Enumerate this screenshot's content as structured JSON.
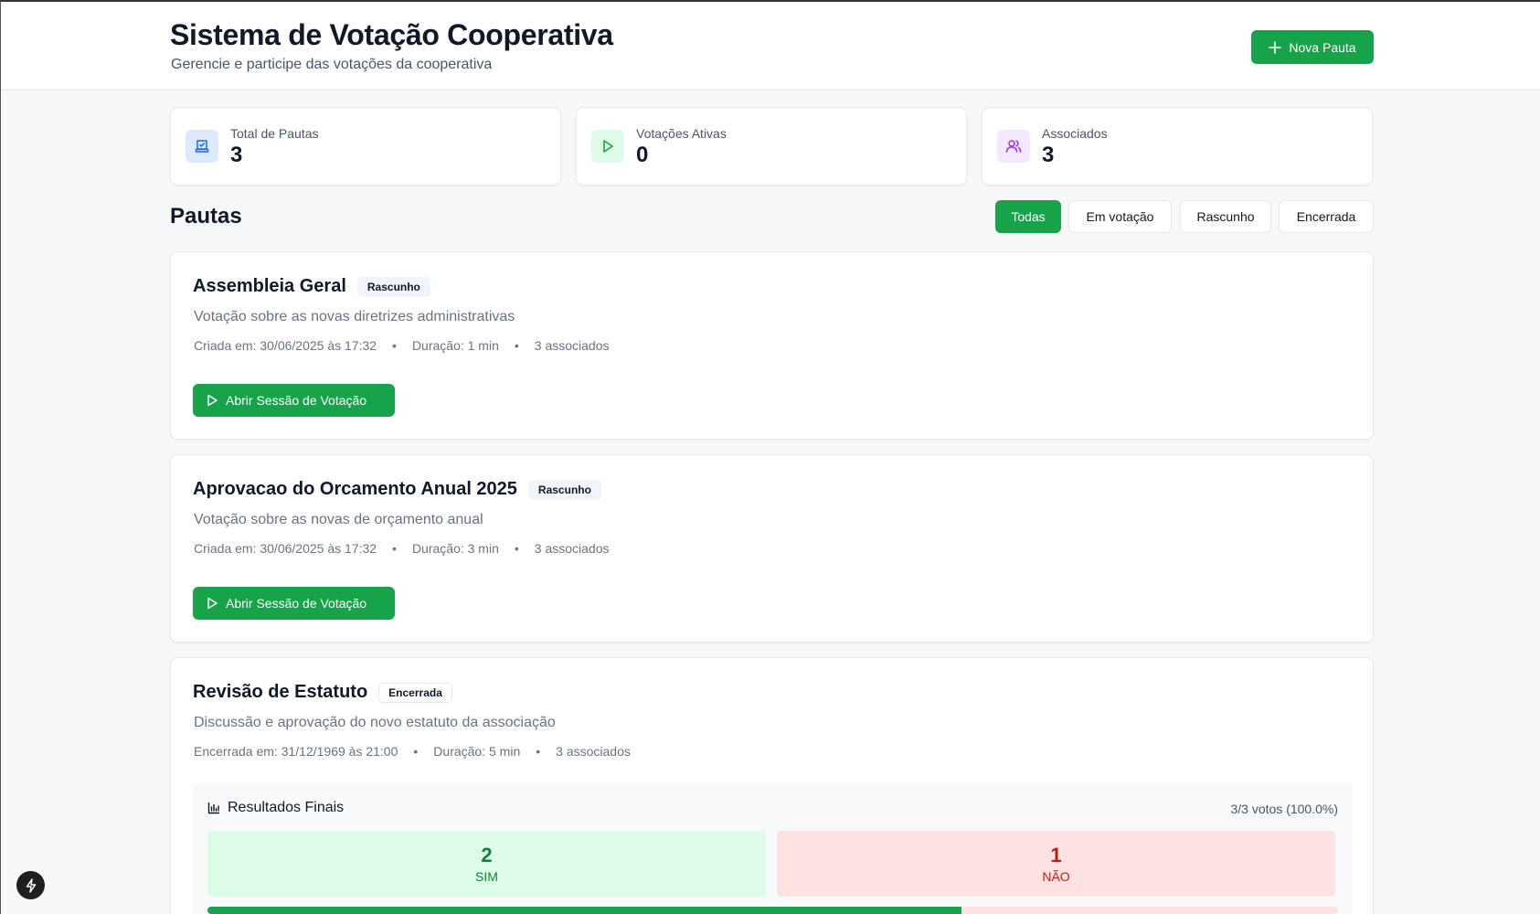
{
  "header": {
    "title": "Sistema de Votação Cooperativa",
    "subtitle": "Gerencie e participe das votações da cooperativa",
    "new_button_label": "Nova Pauta",
    "new_button_icon": "plus-icon"
  },
  "stats": [
    {
      "label": "Total de Pautas",
      "value": "3",
      "icon": "ballot-box-icon",
      "bg": "#dbeafe",
      "color": "#2563eb"
    },
    {
      "label": "Votações Ativas",
      "value": "0",
      "icon": "play-icon",
      "bg": "#dcfce7",
      "color": "#16a34a"
    },
    {
      "label": "Associados",
      "value": "3",
      "icon": "users-icon",
      "bg": "#f3e8ff",
      "color": "#9333ea"
    }
  ],
  "section": {
    "title": "Pautas",
    "filters": [
      "Todas",
      "Em votação",
      "Rascunho",
      "Encerrada"
    ],
    "active_filter": "Todas"
  },
  "pautas": [
    {
      "title": "Assembleia Geral",
      "status": "Rascunho",
      "description": "Votação sobre as novas diretrizes administrativas",
      "date": "Criada em: 30/06/2025 às 17:32",
      "duration": "Duração: 1 min",
      "members": "3 associados",
      "action_label": "Abrir Sessão de Votação"
    },
    {
      "title": "Aprovacao do Orcamento Anual 2025",
      "status": "Rascunho",
      "description": "Votação sobre as novas de orçamento anual",
      "date": "Criada em: 30/06/2025 às 17:32",
      "duration": "Duração: 3 min",
      "members": "3 associados",
      "action_label": "Abrir Sessão de Votação"
    },
    {
      "title": "Revisão de Estatuto",
      "status": "Encerrada",
      "description": "Discussão e aprovação do novo estatuto da associação",
      "date": "Encerrada em: 31/12/1969 às 21:00",
      "duration": "Duração: 5 min",
      "members": "3 associados",
      "results": {
        "title": "Resultados Finais",
        "count": "3/3 votos (100.0%)",
        "yes_value": "2",
        "yes_label": "SIM",
        "no_value": "1",
        "no_label": "NÃO",
        "yes_fraction": 0.6667
      }
    }
  ],
  "colors": {
    "accent": "#16a34a",
    "yes": "#15803d",
    "no": "#b91c1c"
  }
}
